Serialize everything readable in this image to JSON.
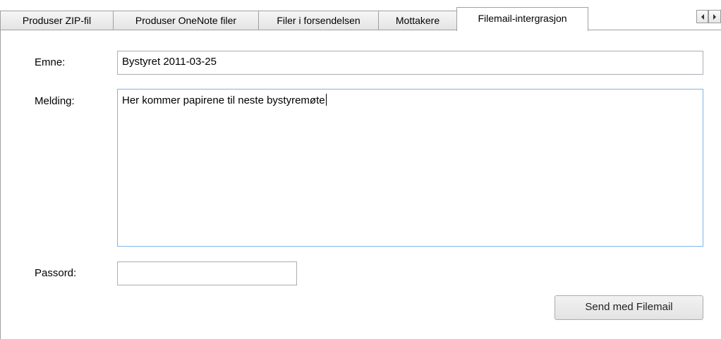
{
  "tabs": [
    {
      "label": "Produser ZIP-fil",
      "active": false
    },
    {
      "label": "Produser OneNote filer",
      "active": false
    },
    {
      "label": "Filer i forsendelsen",
      "active": false
    },
    {
      "label": "Mottakere",
      "active": false
    },
    {
      "label": "Filemail-intergrasjon",
      "active": true
    }
  ],
  "scroll": {
    "left_icon": "arrow-left-icon",
    "right_icon": "arrow-right-icon"
  },
  "form": {
    "subject_label": "Emne:",
    "subject_value": "Bystyret 2011-03-25",
    "message_label": "Melding:",
    "message_value": "Her kommer papirene til neste bystyremøte",
    "password_label": "Passord:",
    "password_value": "",
    "send_button": "Send med Filemail"
  },
  "colors": {
    "focus_border": "#7eb4ea",
    "tab_border": "#a0a0a0"
  }
}
